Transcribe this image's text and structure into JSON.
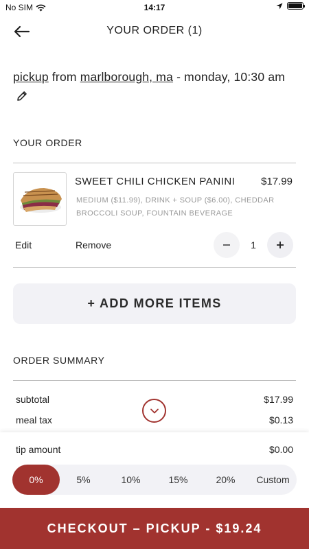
{
  "status_bar": {
    "carrier": "No SIM",
    "time": "14:17"
  },
  "header": {
    "title": "YOUR ORDER (1)"
  },
  "pickup": {
    "mode": "pickup",
    "from_word": " from ",
    "location": "marlborough, ma",
    "datetime": " - monday, 10:30 am"
  },
  "order": {
    "section_label": "YOUR ORDER",
    "items": [
      {
        "name": "SWEET CHILI CHICKEN PANINI",
        "price": "$17.99",
        "details": "MEDIUM ($11.99), DRINK + SOUP ($6.00), CHEDDAR BROCCOLI SOUP, FOUNTAIN BEVERAGE",
        "quantity": "1",
        "edit_label": "Edit",
        "remove_label": "Remove"
      }
    ]
  },
  "add_more_label": "+ ADD MORE ITEMS",
  "summary": {
    "section_label": "ORDER SUMMARY",
    "subtotal_label": "subtotal",
    "subtotal_value": "$17.99",
    "tax_label": "meal tax",
    "tax_value": "$0.13"
  },
  "tip": {
    "label": "tip amount",
    "value": "$0.00",
    "options": [
      "0%",
      "5%",
      "10%",
      "15%",
      "20%",
      "Custom"
    ],
    "selected": "0%"
  },
  "checkout_label": "CHECKOUT – PICKUP - $19.24",
  "colors": {
    "accent": "#a1332f",
    "surface": "#f2f2f6",
    "muted_text": "#9a9a9a"
  },
  "icons": {
    "back": "arrow-left-icon",
    "edit": "pencil-icon",
    "expand": "chevron-down-icon",
    "wifi": "wifi-icon",
    "location": "location-arrow-icon",
    "battery": "battery-icon"
  }
}
